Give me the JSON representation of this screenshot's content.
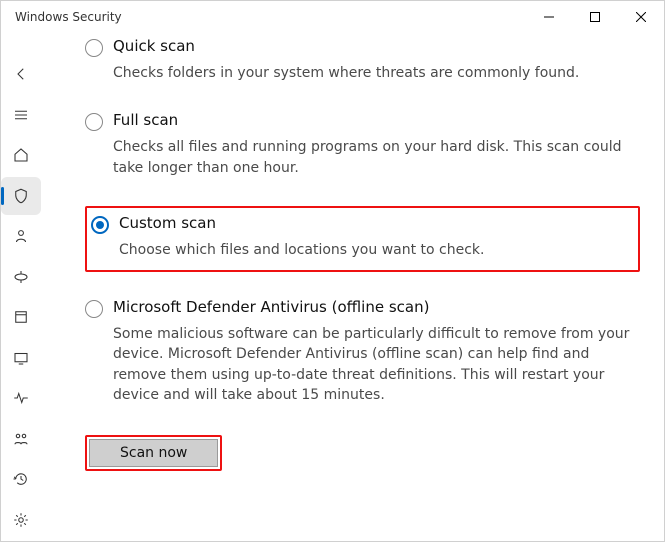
{
  "window": {
    "title": "Windows Security"
  },
  "options": {
    "quick": {
      "title": "Quick scan",
      "desc": "Checks folders in your system where threats are commonly found."
    },
    "full": {
      "title": "Full scan",
      "desc": "Checks all files and running programs on your hard disk. This scan could take longer than one hour."
    },
    "custom": {
      "title": "Custom scan",
      "desc": "Choose which files and locations you want to check."
    },
    "offline": {
      "title": "Microsoft Defender Antivirus (offline scan)",
      "desc": "Some malicious software can be particularly difficult to remove from your device. Microsoft Defender Antivirus (offline scan) can help find and remove them using up-to-date threat definitions. This will restart your device and will take about 15 minutes."
    }
  },
  "actions": {
    "scan_now": "Scan now"
  }
}
